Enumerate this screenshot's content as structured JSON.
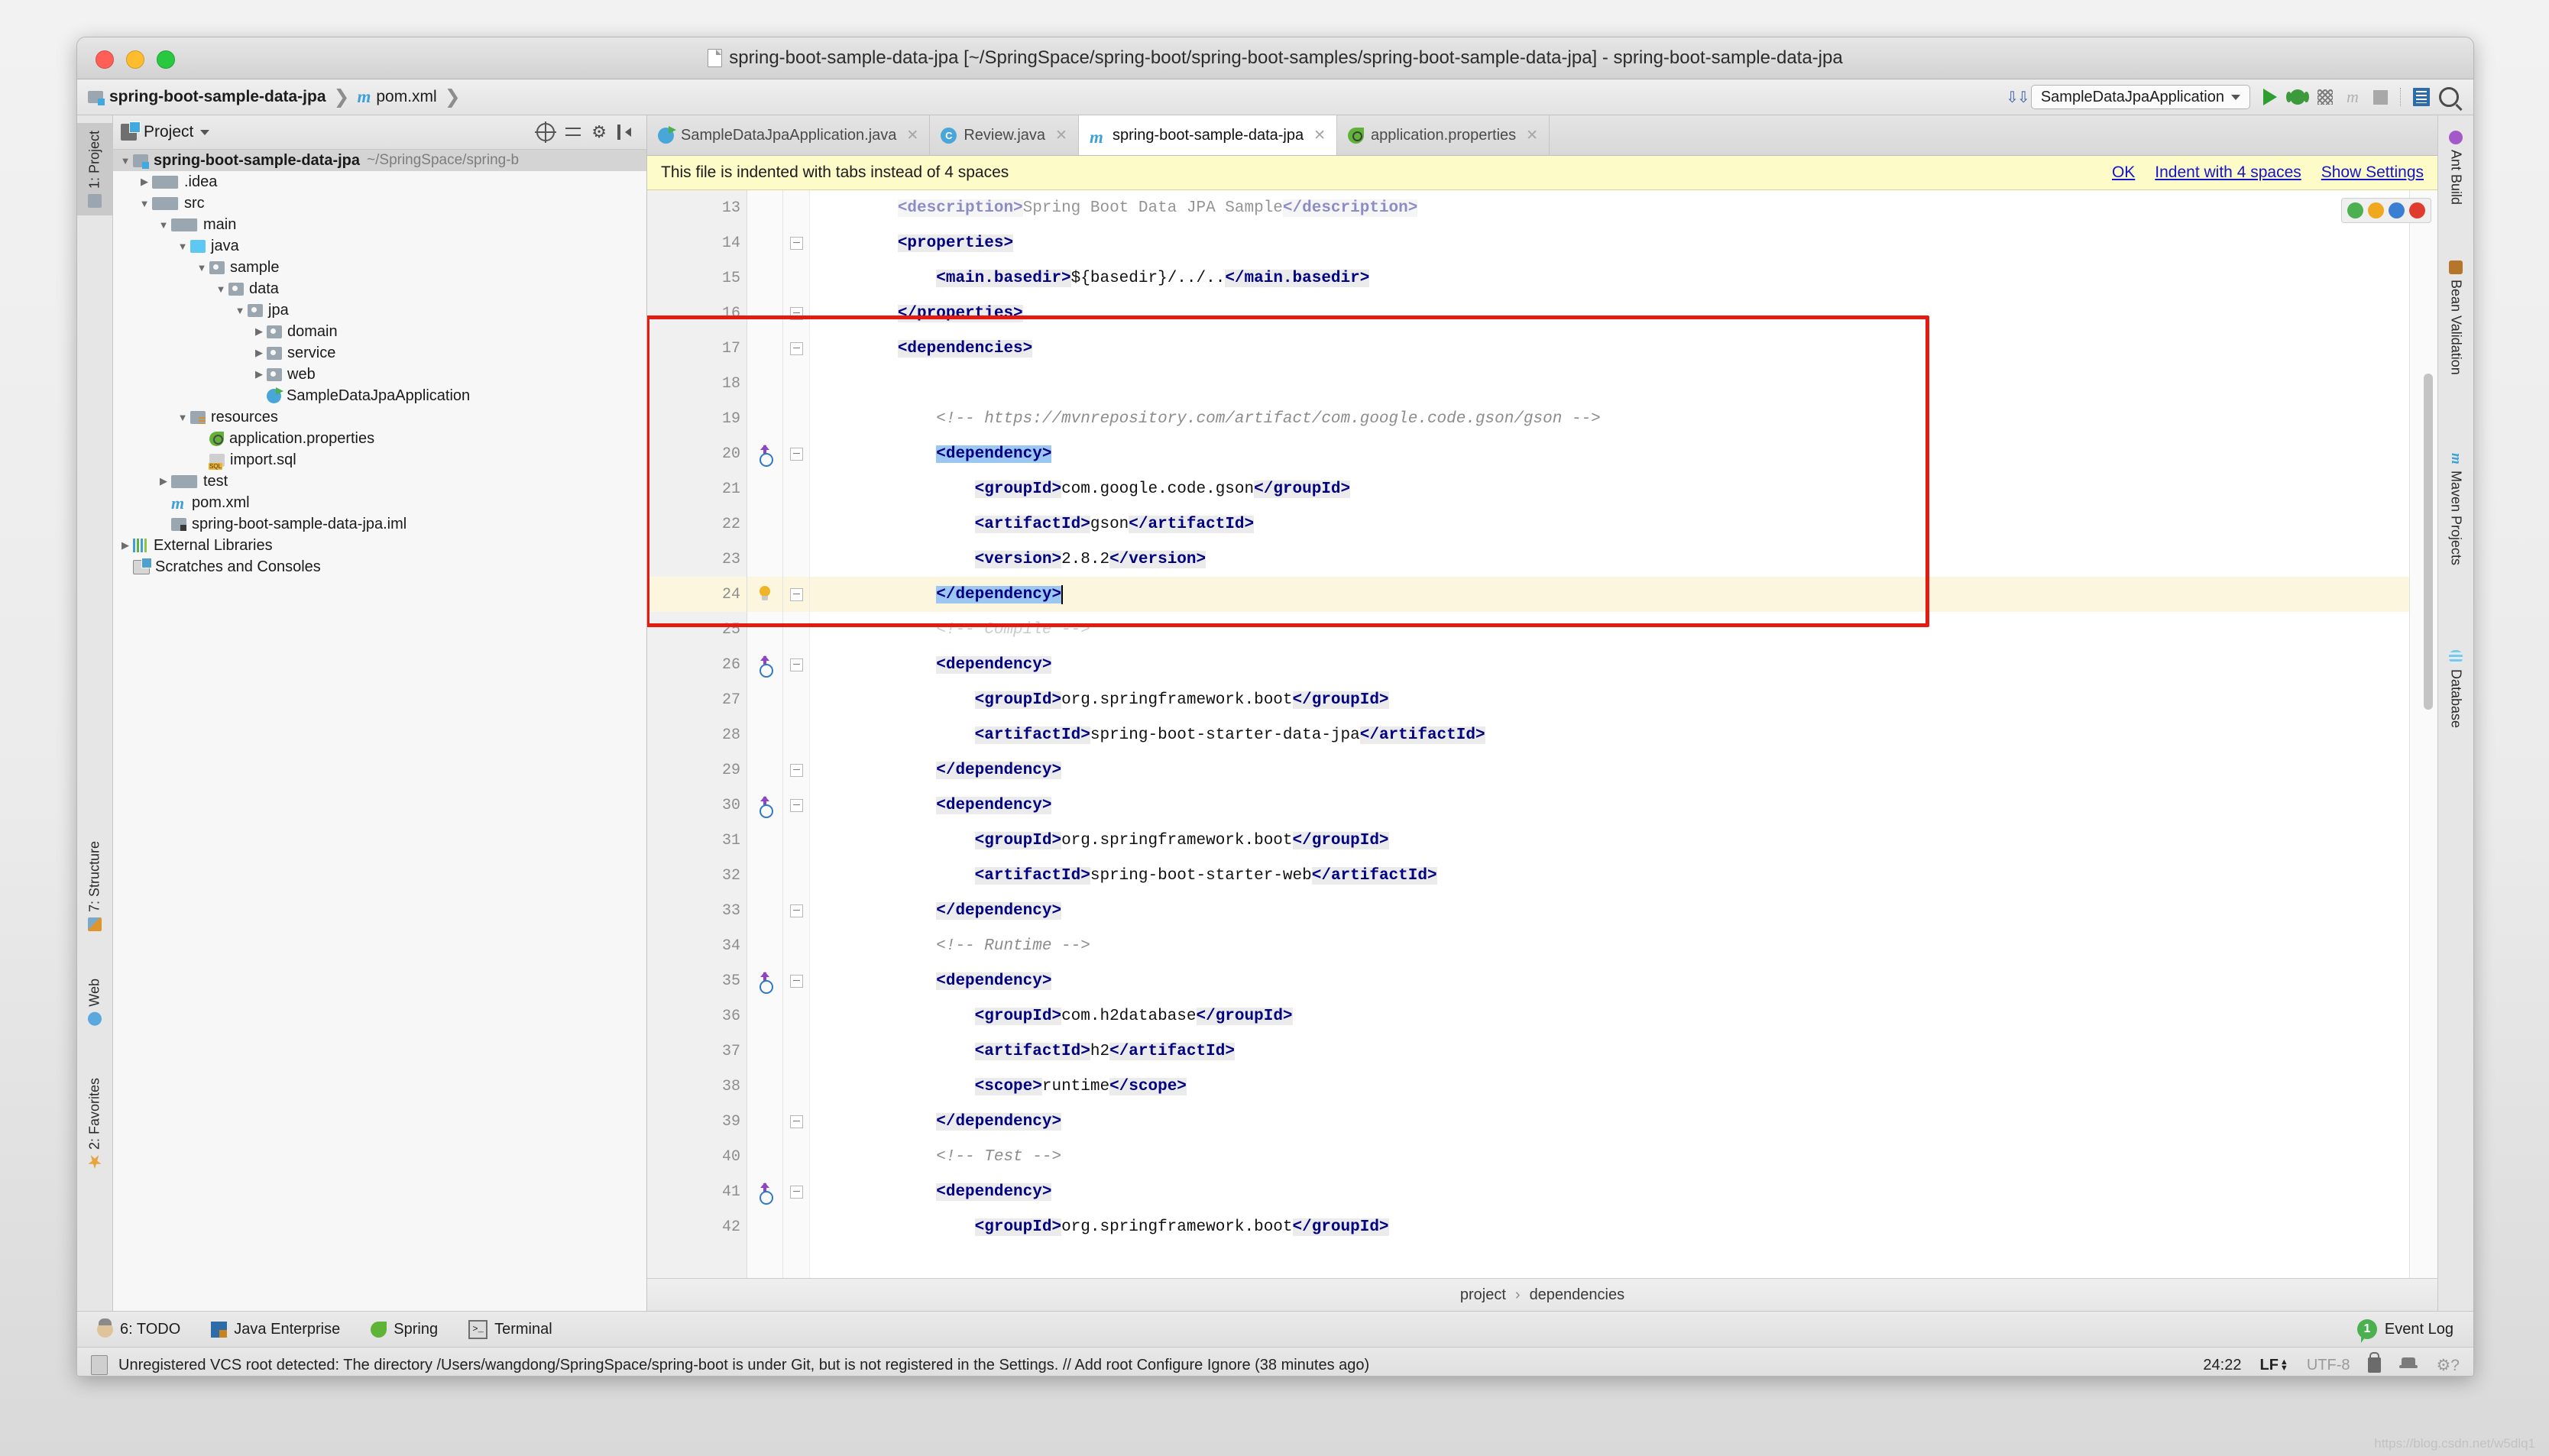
{
  "window": {
    "title": "spring-boot-sample-data-jpa [~/SpringSpace/spring-boot/spring-boot-samples/spring-boot-sample-data-jpa] - spring-boot-sample-data-jpa"
  },
  "breadcrumb": {
    "project": "spring-boot-sample-data-jpa",
    "file": "pom.xml",
    "sep": "❯"
  },
  "toolbar": {
    "run_config": "SampleDataJpaApplication",
    "icons": [
      "run-icon",
      "debug-icon",
      "coverage-icon",
      "profile-icon",
      "stop-icon",
      "layout-icon",
      "search-everywhere-icon"
    ]
  },
  "project_panel": {
    "title": "Project",
    "tree": [
      {
        "depth": 0,
        "arrow": "open",
        "icon": "proj",
        "label": "spring-boot-sample-data-jpa",
        "path": "~/SpringSpace/spring-b",
        "selected": true,
        "bold": true
      },
      {
        "depth": 1,
        "arrow": "closed",
        "icon": "fold",
        "label": ".idea"
      },
      {
        "depth": 1,
        "arrow": "open",
        "icon": "fold",
        "label": "src"
      },
      {
        "depth": 2,
        "arrow": "open",
        "icon": "fold",
        "label": "main"
      },
      {
        "depth": 3,
        "arrow": "open",
        "icon": "fold-src",
        "label": "java"
      },
      {
        "depth": 4,
        "arrow": "open",
        "icon": "pkg",
        "label": "sample"
      },
      {
        "depth": 5,
        "arrow": "open",
        "icon": "pkg",
        "label": "data"
      },
      {
        "depth": 6,
        "arrow": "open",
        "icon": "pkg",
        "label": "jpa"
      },
      {
        "depth": 7,
        "arrow": "closed",
        "icon": "pkg",
        "label": "domain"
      },
      {
        "depth": 7,
        "arrow": "closed",
        "icon": "pkg",
        "label": "service"
      },
      {
        "depth": 7,
        "arrow": "closed",
        "icon": "pkg",
        "label": "web"
      },
      {
        "depth": 7,
        "arrow": "none",
        "icon": "cls",
        "label": "SampleDataJpaApplication"
      },
      {
        "depth": 3,
        "arrow": "open",
        "icon": "fold-res",
        "label": "resources"
      },
      {
        "depth": 4,
        "arrow": "none",
        "icon": "leaf",
        "label": "application.properties"
      },
      {
        "depth": 4,
        "arrow": "none",
        "icon": "sql",
        "label": "import.sql"
      },
      {
        "depth": 2,
        "arrow": "closed",
        "icon": "fold",
        "label": "test"
      },
      {
        "depth": 2,
        "arrow": "none",
        "icon": "mvn",
        "label": "pom.xml"
      },
      {
        "depth": 2,
        "arrow": "none",
        "icon": "iml",
        "label": "spring-boot-sample-data-jpa.iml"
      },
      {
        "depth": 0,
        "arrow": "closed",
        "icon": "libs",
        "label": "External Libraries"
      },
      {
        "depth": 0,
        "arrow": "none",
        "icon": "scr",
        "label": "Scratches and Consoles"
      }
    ]
  },
  "left_tool_strip": [
    {
      "label": "1: Project",
      "icon": "project-icon",
      "selected": true
    },
    {
      "label": "7: Structure",
      "icon": "structure-icon",
      "selected": false
    },
    {
      "label": "Web",
      "icon": "web-icon",
      "selected": false
    },
    {
      "label": "2: Favorites",
      "icon": "favorites-icon",
      "selected": false
    }
  ],
  "right_tool_strip": [
    {
      "label": "Ant Build",
      "icon": "ant-icon"
    },
    {
      "label": "Bean Validation",
      "icon": "bean-icon"
    },
    {
      "label": "Maven Projects",
      "icon": "maven-icon"
    },
    {
      "label": "Database",
      "icon": "database-icon"
    }
  ],
  "editor_tabs": [
    {
      "label": "SampleDataJpaApplication.java",
      "icon": "java-class-run-icon",
      "active": false
    },
    {
      "label": "Review.java",
      "icon": "java-class-icon",
      "active": false
    },
    {
      "label": "spring-boot-sample-data-jpa",
      "icon": "maven-icon",
      "active": true
    },
    {
      "label": "application.properties",
      "icon": "spring-properties-icon",
      "active": false
    }
  ],
  "notification": {
    "message": "This file is indented with tabs instead of 4 spaces",
    "actions": [
      "OK",
      "Indent with 4 spaces",
      "Show Settings"
    ]
  },
  "code": {
    "first_line": 13,
    "lines": [
      {
        "n": 13,
        "partial": true,
        "indent": 2,
        "segments": [
          {
            "t": "tag",
            "v": "<description>"
          },
          {
            "t": "txt",
            "v": "Spring Boot Data JPA Sample"
          },
          {
            "t": "tag",
            "v": "</description>"
          }
        ]
      },
      {
        "n": 14,
        "fold": "start",
        "indent": 2,
        "segments": [
          {
            "t": "tag",
            "v": "<properties>"
          }
        ]
      },
      {
        "n": 15,
        "indent": 3,
        "segments": [
          {
            "t": "tag",
            "v": "<main.basedir>"
          },
          {
            "t": "txt",
            "v": "${basedir}/../.."
          },
          {
            "t": "tag",
            "v": "</main.basedir>"
          }
        ]
      },
      {
        "n": 16,
        "fold": "end",
        "indent": 2,
        "segments": [
          {
            "t": "tag",
            "v": "</properties>"
          }
        ]
      },
      {
        "n": 17,
        "fold": "start",
        "indent": 2,
        "segments": [
          {
            "t": "tag",
            "v": "<dependencies>"
          }
        ]
      },
      {
        "n": 18,
        "indent": 2,
        "segments": []
      },
      {
        "n": 19,
        "indent": 3,
        "segments": [
          {
            "t": "cmt",
            "v": "<!-- https://mvnrepository.com/artifact/com.google.code.gson/gson -->"
          }
        ]
      },
      {
        "n": 20,
        "fold": "start",
        "gutter": "maven-up-icon",
        "indent": 3,
        "segments": [
          {
            "t": "sel",
            "v": "<dependency>"
          }
        ]
      },
      {
        "n": 21,
        "indent": 4,
        "segments": [
          {
            "t": "tag",
            "v": "<groupId>"
          },
          {
            "t": "txt",
            "v": "com.google.code.gson"
          },
          {
            "t": "tag",
            "v": "</groupId>"
          }
        ]
      },
      {
        "n": 22,
        "indent": 4,
        "segments": [
          {
            "t": "tag",
            "v": "<artifactId>"
          },
          {
            "t": "txt",
            "v": "gson"
          },
          {
            "t": "tag",
            "v": "</artifactId>"
          }
        ]
      },
      {
        "n": 23,
        "indent": 4,
        "segments": [
          {
            "t": "tag",
            "v": "<version>"
          },
          {
            "t": "txt",
            "v": "2.8.2"
          },
          {
            "t": "tag",
            "v": "</version>"
          }
        ]
      },
      {
        "n": 24,
        "fold": "end",
        "gutter": "intention-bulb-icon",
        "highlight": true,
        "caret": true,
        "indent": 3,
        "segments": [
          {
            "t": "sel",
            "v": "</dependency>"
          }
        ]
      },
      {
        "n": 25,
        "indent": 3,
        "partial": true,
        "segments": [
          {
            "t": "cmt",
            "v": "<!-- Compile -->"
          }
        ]
      },
      {
        "n": 26,
        "fold": "start",
        "gutter": "maven-up-icon",
        "indent": 3,
        "segments": [
          {
            "t": "tag",
            "v": "<dependency>"
          }
        ]
      },
      {
        "n": 27,
        "indent": 4,
        "segments": [
          {
            "t": "tag",
            "v": "<groupId>"
          },
          {
            "t": "txt",
            "v": "org.springframework.boot"
          },
          {
            "t": "tag",
            "v": "</groupId>"
          }
        ]
      },
      {
        "n": 28,
        "indent": 4,
        "segments": [
          {
            "t": "tag",
            "v": "<artifactId>"
          },
          {
            "t": "txt",
            "v": "spring-boot-starter-data-jpa"
          },
          {
            "t": "tag",
            "v": "</artifactId>"
          }
        ]
      },
      {
        "n": 29,
        "fold": "end",
        "indent": 3,
        "segments": [
          {
            "t": "tag",
            "v": "</dependency>"
          }
        ]
      },
      {
        "n": 30,
        "fold": "start",
        "gutter": "maven-up-icon",
        "indent": 3,
        "segments": [
          {
            "t": "tag",
            "v": "<dependency>"
          }
        ]
      },
      {
        "n": 31,
        "indent": 4,
        "segments": [
          {
            "t": "tag",
            "v": "<groupId>"
          },
          {
            "t": "txt",
            "v": "org.springframework.boot"
          },
          {
            "t": "tag",
            "v": "</groupId>"
          }
        ]
      },
      {
        "n": 32,
        "indent": 4,
        "segments": [
          {
            "t": "tag",
            "v": "<artifactId>"
          },
          {
            "t": "txt",
            "v": "spring-boot-starter-web"
          },
          {
            "t": "tag",
            "v": "</artifactId>"
          }
        ]
      },
      {
        "n": 33,
        "fold": "end",
        "indent": 3,
        "segments": [
          {
            "t": "tag",
            "v": "</dependency>"
          }
        ]
      },
      {
        "n": 34,
        "indent": 3,
        "segments": [
          {
            "t": "cmt",
            "v": "<!-- Runtime -->"
          }
        ]
      },
      {
        "n": 35,
        "fold": "start",
        "gutter": "maven-up-icon",
        "indent": 3,
        "segments": [
          {
            "t": "tag",
            "v": "<dependency>"
          }
        ]
      },
      {
        "n": 36,
        "indent": 4,
        "segments": [
          {
            "t": "tag",
            "v": "<groupId>"
          },
          {
            "t": "txt",
            "v": "com.h2database"
          },
          {
            "t": "tag",
            "v": "</groupId>"
          }
        ]
      },
      {
        "n": 37,
        "indent": 4,
        "segments": [
          {
            "t": "tag",
            "v": "<artifactId>"
          },
          {
            "t": "txt",
            "v": "h2"
          },
          {
            "t": "tag",
            "v": "</artifactId>"
          }
        ]
      },
      {
        "n": 38,
        "indent": 4,
        "segments": [
          {
            "t": "tag",
            "v": "<scope>"
          },
          {
            "t": "txt",
            "v": "runtime"
          },
          {
            "t": "tag",
            "v": "</scope>"
          }
        ]
      },
      {
        "n": 39,
        "fold": "end",
        "indent": 3,
        "segments": [
          {
            "t": "tag",
            "v": "</dependency>"
          }
        ]
      },
      {
        "n": 40,
        "indent": 3,
        "segments": [
          {
            "t": "cmt",
            "v": "<!-- Test -->"
          }
        ]
      },
      {
        "n": 41,
        "fold": "start",
        "gutter": "maven-up-icon",
        "indent": 3,
        "segments": [
          {
            "t": "tag",
            "v": "<dependency>"
          }
        ]
      },
      {
        "n": 42,
        "indent": 4,
        "partial": true,
        "segments": [
          {
            "t": "tag",
            "v": "<groupId>"
          },
          {
            "t": "txt",
            "v": "org.springframework.boot"
          },
          {
            "t": "tag",
            "v": "</groupId>"
          }
        ]
      }
    ]
  },
  "editor_breadcrumb": {
    "items": [
      "project",
      "dependencies"
    ],
    "sep": "›"
  },
  "bottom_tools": [
    {
      "label": "6: TODO",
      "icon": "todo-icon"
    },
    {
      "label": "Java Enterprise",
      "icon": "java-enterprise-icon"
    },
    {
      "label": "Spring",
      "icon": "spring-icon"
    },
    {
      "label": "Terminal",
      "icon": "terminal-icon"
    }
  ],
  "event_log": {
    "count": "1",
    "label": "Event Log"
  },
  "status": {
    "message": "Unregistered VCS root detected: The directory /Users/wangdong/SpringSpace/spring-boot is under Git, but is not registered in the Settings. // Add root  Configure  Ignore (38 minutes ago)",
    "caret": "24:22",
    "line_sep": "LF",
    "encoding": "UTF-8",
    "icons": [
      "lock-icon",
      "hector-icon",
      "settings-question-icon"
    ]
  },
  "colors": {
    "accent_red": "#e41b13",
    "selection_blue": "#9cc7f2",
    "tag_navy": "#000080",
    "notification_yellow": "#fdfbc8",
    "link_blue": "#1414c8",
    "green_run": "#2e9e32"
  },
  "watermark": "https://blog.csdn.net/w5dlq1"
}
